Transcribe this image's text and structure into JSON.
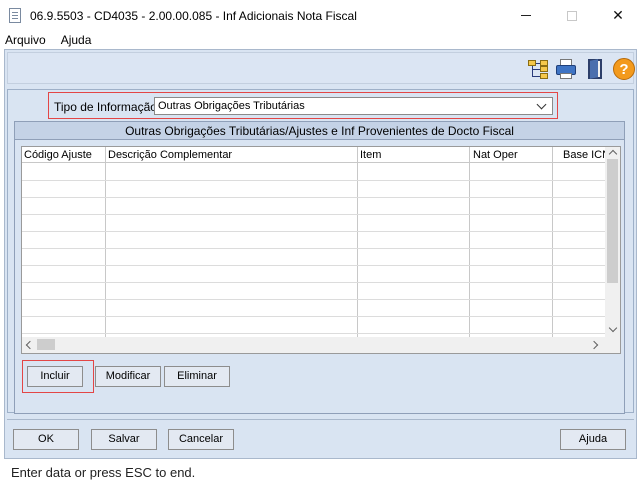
{
  "window": {
    "title": "06.9.5503 - CD4035 - 2.00.00.085 - Inf Adicionais Nota Fiscal",
    "close_glyph": "✕"
  },
  "menu": [
    "Arquivo",
    "Ajuda"
  ],
  "toolbar": {
    "icons": [
      "tree-icon",
      "printer-icon",
      "exit-door-icon",
      "help-icon"
    ],
    "help_glyph": "?"
  },
  "tipo": {
    "label": "Tipo de Informação:",
    "value": "Outras Obrigações Tributárias"
  },
  "group": {
    "title": "Outras Obrigações Tributárias/Ajustes e Inf Provenientes de Docto Fiscal"
  },
  "grid": {
    "columns": [
      "Código Ajuste",
      "Descrição Complementar",
      "Item",
      "Nat Oper",
      "Base ICN"
    ],
    "rows": []
  },
  "grid_buttons": {
    "incluir": "Incluir",
    "modificar": "Modificar",
    "eliminar": "Eliminar"
  },
  "dialog_buttons": {
    "ok": "OK",
    "salvar": "Salvar",
    "cancelar": "Cancelar",
    "ajuda": "Ajuda"
  },
  "status": "Enter data or press ESC to end.",
  "colors": {
    "panel": "#d9e4f2",
    "highlight": "#e34646",
    "help_orange": "#f39a1d"
  }
}
